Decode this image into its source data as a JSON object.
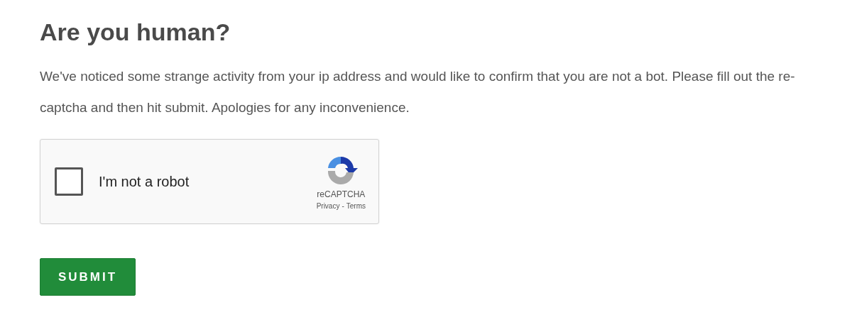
{
  "heading": "Are you human?",
  "message": "We've noticed some strange activity from your ip address and would like to confirm that you are not a bot. Please fill out the re-captcha and then hit submit. Apologies for any inconvenience.",
  "captcha": {
    "label": "I'm not a robot",
    "checked": false,
    "brand": "reCAPTCHA",
    "links": [
      "Privacy",
      "Terms"
    ],
    "separator": "-"
  },
  "submit_button": "SUBMIT"
}
